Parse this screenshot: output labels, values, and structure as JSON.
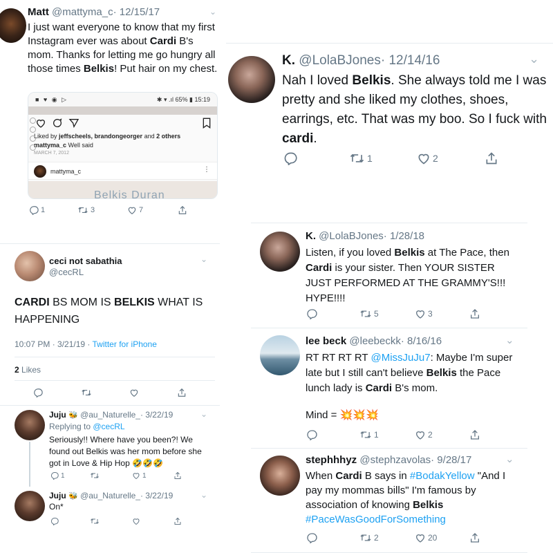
{
  "matt": {
    "name": "Matt",
    "handle": "@mattyma_c",
    "date": "· 12/15/17",
    "text_parts": [
      "I just want everyone to know that my first Instagram ever was about ",
      "Cardi",
      " B's mom. Thanks for letting me go hungry all those times ",
      "Belkis",
      "! Put hair on my chest."
    ],
    "phone": {
      "status_battery": "65%",
      "status_time": "15:19",
      "liked_by_prefix": "Liked by ",
      "liked_by_names": "jeffscheels, brandongeorger",
      "liked_by_and": " and ",
      "liked_by_others": "2 others",
      "caption_user": "mattyma_c",
      "caption_text": " Well said",
      "post_date": "MARCH 7, 2012",
      "comment_user": "mattyma_c",
      "photo_text": "Belkis Duran"
    },
    "replies": "1",
    "retweets": "3",
    "likes": "7"
  },
  "lola1": {
    "name": "K.",
    "handle": "@LolaBJones",
    "date": "· 12/14/16",
    "text_parts": [
      "Nah I loved ",
      "Belkis",
      ". She always told me I was pretty and she liked my clothes, shoes, earrings, etc. That was my boo. So I fuck with ",
      "cardi",
      "."
    ],
    "retweets": "1",
    "likes": "2"
  },
  "lola2": {
    "name": "K.",
    "handle": "@LolaBJones",
    "date": "· 1/28/18",
    "text_parts": [
      "Listen, if you loved ",
      "Belkis",
      " at The Pace, then ",
      "Cardi",
      " is your sister. Then YOUR SISTER JUST PERFORMED AT THE GRAMMY'S!!! HYPE!!!!"
    ],
    "retweets": "5",
    "likes": "3"
  },
  "lee": {
    "name": "lee beck",
    "handle": "@leebeckk",
    "date": "· 8/16/16",
    "text_a": "RT RT RT RT ",
    "mention": "@MissJuJu7",
    "text_b": ": Maybe I'm super late but I still can't believe ",
    "bold1": "Belkis",
    "text_c": " the Pace lunch lady is ",
    "bold2": "Cardi",
    "text_d": " B's mom.",
    "mind": "Mind = ",
    "emoji": "💥💥💥",
    "retweets": "1",
    "likes": "2"
  },
  "steph": {
    "name": "stephhhyz",
    "handle": "@stephzavolas",
    "date": "· 9/28/17",
    "text_a": "When ",
    "bold1": "Cardi",
    "text_b": " B says in ",
    "hashtag1": "#BodakYellow",
    "text_c": " \"And I pay my mommas bills\" I'm famous by association of knowing ",
    "bold2": "Belkis",
    "hashtag2": " #PaceWasGoodForSomething",
    "retweets": "2",
    "likes": "20"
  },
  "ceci": {
    "name": "ceci not sabathia",
    "handle": "@cecRL",
    "text_bold1": "CARDI",
    "text_mid": " BS MOM IS ",
    "text_bold2": "BELKIS",
    "text_end": " WHAT IS HAPPENING",
    "time": "10:07 PM · 3/21/19 · ",
    "source": "Twitter for iPhone",
    "likes_count": "2",
    "likes_label": " Likes"
  },
  "juju1": {
    "name": "Juju",
    "badge": "🐝",
    "handle": "@au_Naturelle_",
    "date": "· 3/22/19",
    "replying_prefix": "Replying to ",
    "replying_to": "@cecRL",
    "text": "Seriously!! Where have you been?! We found out Belkis was her mom before she got in Love & Hip Hop 🤣🤣🤣",
    "replies": "1",
    "likes": "1"
  },
  "juju2": {
    "name": "Juju",
    "badge": "🐝",
    "handle": "@au_Naturelle_",
    "date": "· 3/22/19",
    "text": "On*"
  },
  "colors": {
    "accent": "#1da1f2",
    "text": "#14171a",
    "secondary": "#657786",
    "divider": "#e6ecf0"
  }
}
